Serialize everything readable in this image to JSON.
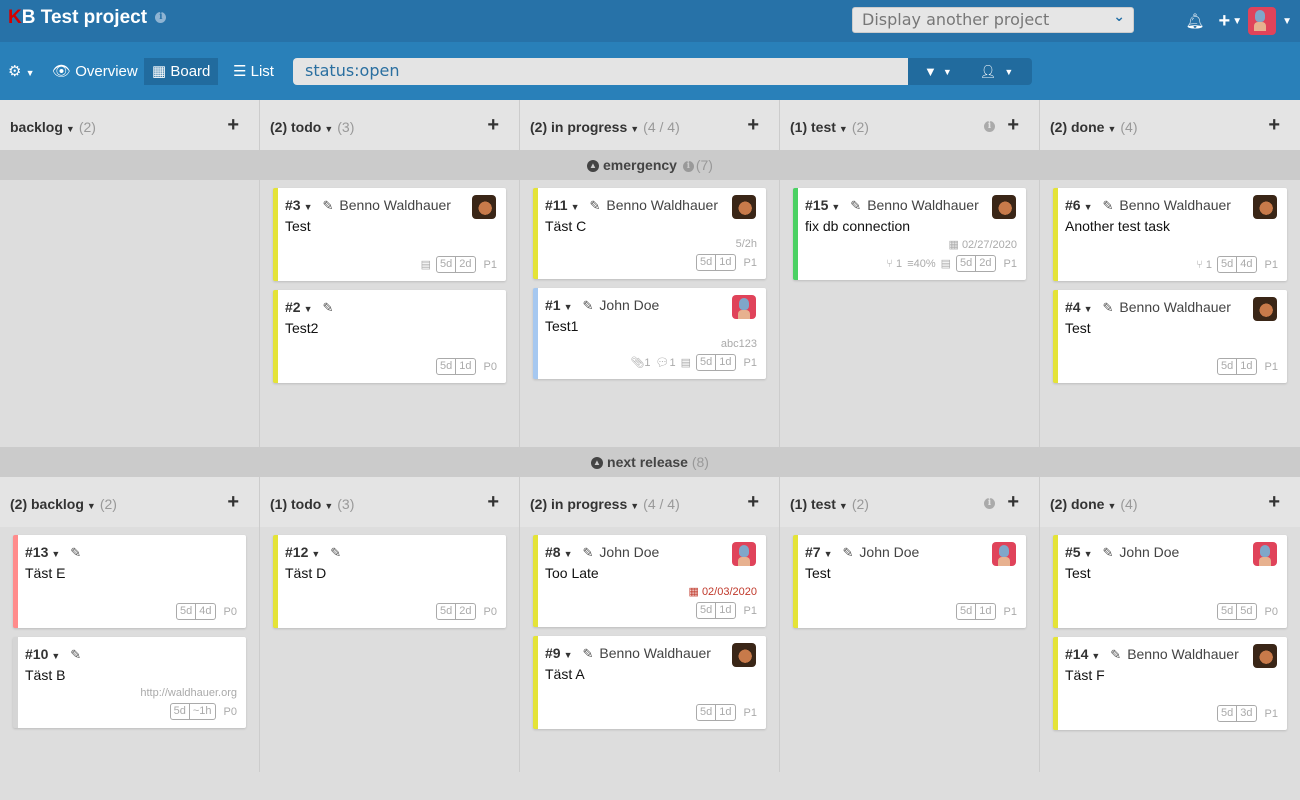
{
  "header": {
    "logo_first": "K",
    "logo_rest": "B",
    "project_title": "Test project",
    "project_selector_placeholder": "Display another project"
  },
  "subnav": {
    "settings_icon": "gear-icon",
    "overview_label": "Overview",
    "board_label": "Board",
    "list_label": "List",
    "search_value": "status:open"
  },
  "swimlanes": [
    {
      "name": "emergency",
      "count": "(7)",
      "has_info": true,
      "columns": [
        {
          "label": "backlog",
          "count": "(2)",
          "info": false,
          "cards": []
        },
        {
          "label": "(2) todo",
          "count": "(3)",
          "info": false,
          "cards": [
            {
              "id": "#3",
              "owner": "Benno Waldhauer",
              "avatar": "benno",
              "title": "Test",
              "color": "#e4e337",
              "meta": "",
              "foot": {
                "desc": true,
                "est": [
                  "5d",
                  "2d"
                ],
                "priority": "P1"
              }
            },
            {
              "id": "#2",
              "owner": "",
              "avatar": "",
              "title": "Test2",
              "color": "#e4e337",
              "meta": "",
              "foot": {
                "est": [
                  "5d",
                  "1d"
                ],
                "priority": "P0"
              }
            }
          ]
        },
        {
          "label": "(2) in progress",
          "count": "(4 / 4)",
          "info": false,
          "cards": [
            {
              "id": "#11",
              "owner": "Benno Waldhauer",
              "avatar": "benno",
              "title": "Täst C",
              "color": "#e4e337",
              "meta": "5/2h",
              "foot": {
                "est": [
                  "5d",
                  "1d"
                ],
                "priority": "P1"
              }
            },
            {
              "id": "#1",
              "owner": "John Doe",
              "avatar": "john",
              "title": "Test1",
              "color": "#a6c8f0",
              "meta": "abc123",
              "foot": {
                "attachments": "1",
                "comments": "1",
                "desc": true,
                "est": [
                  "5d",
                  "1d"
                ],
                "priority": "P1"
              }
            }
          ]
        },
        {
          "label": "(1) test",
          "count": "(2)",
          "info": true,
          "cards": [
            {
              "id": "#15",
              "owner": "Benno Waldhauer",
              "avatar": "benno",
              "title": "fix db connection",
              "color": "#4bd163",
              "meta": "02/27/2020",
              "meta_icon": "calendar",
              "foot": {
                "links": "1",
                "progress": "40%",
                "desc": true,
                "est": [
                  "5d",
                  "2d"
                ],
                "priority": "P1"
              }
            }
          ]
        },
        {
          "label": "(2) done",
          "count": "(4)",
          "info": false,
          "cards": [
            {
              "id": "#6",
              "owner": "Benno Waldhauer",
              "avatar": "benno",
              "title": "Another test task",
              "color": "#e4e337",
              "meta": "",
              "foot": {
                "links": "1",
                "est": [
                  "5d",
                  "4d"
                ],
                "priority": "P1"
              }
            },
            {
              "id": "#4",
              "owner": "Benno Waldhauer",
              "avatar": "benno",
              "title": "Test",
              "color": "#e4e337",
              "meta": "",
              "foot": {
                "est": [
                  "5d",
                  "1d"
                ],
                "priority": "P1"
              }
            }
          ]
        }
      ]
    },
    {
      "name": "next release",
      "count": "(8)",
      "has_info": false,
      "columns": [
        {
          "label": "(2) backlog",
          "count": "(2)",
          "info": false,
          "cards": [
            {
              "id": "#13",
              "owner": "",
              "avatar": "",
              "title": "Täst E",
              "color": "#ff8c8c",
              "meta": "",
              "foot": {
                "est": [
                  "5d",
                  "4d"
                ],
                "priority": "P0"
              }
            },
            {
              "id": "#10",
              "owner": "",
              "avatar": "",
              "title": "Täst B",
              "color": "#d5d5d5",
              "meta": "http://waldhauer.org",
              "foot": {
                "est": [
                  "5d",
                  "~1h"
                ],
                "priority": "P0"
              }
            }
          ]
        },
        {
          "label": "(1) todo",
          "count": "(3)",
          "info": false,
          "cards": [
            {
              "id": "#12",
              "owner": "",
              "avatar": "",
              "title": "Täst D",
              "color": "#e4e337",
              "meta": "",
              "foot": {
                "est": [
                  "5d",
                  "2d"
                ],
                "priority": "P0"
              }
            }
          ]
        },
        {
          "label": "(2) in progress",
          "count": "(4 / 4)",
          "info": false,
          "cards": [
            {
              "id": "#8",
              "owner": "John Doe",
              "avatar": "john",
              "title": "Too Late",
              "color": "#e4e337",
              "meta": "02/03/2020",
              "meta_icon": "calendar",
              "meta_overdue": true,
              "foot": {
                "est": [
                  "5d",
                  "1d"
                ],
                "priority": "P1"
              }
            },
            {
              "id": "#9",
              "owner": "Benno Waldhauer",
              "avatar": "benno",
              "title": "Täst A",
              "color": "#e4e337",
              "meta": "",
              "foot": {
                "est": [
                  "5d",
                  "1d"
                ],
                "priority": "P1"
              }
            }
          ]
        },
        {
          "label": "(1) test",
          "count": "(2)",
          "info": true,
          "cards": [
            {
              "id": "#7",
              "owner": "John Doe",
              "avatar": "john",
              "title": "Test",
              "color": "#e4e337",
              "meta": "",
              "foot": {
                "est": [
                  "5d",
                  "1d"
                ],
                "priority": "P1"
              }
            }
          ]
        },
        {
          "label": "(2) done",
          "count": "(4)",
          "info": false,
          "cards": [
            {
              "id": "#5",
              "owner": "John Doe",
              "avatar": "john",
              "title": "Test",
              "color": "#e4e337",
              "meta": "",
              "foot": {
                "est": [
                  "5d",
                  "5d"
                ],
                "priority": "P0"
              }
            },
            {
              "id": "#14",
              "owner": "Benno Waldhauer",
              "avatar": "benno",
              "title": "Täst F",
              "color": "#e4e337",
              "meta": "",
              "foot": {
                "est": [
                  "5d",
                  "3d"
                ],
                "priority": "P1"
              }
            }
          ]
        }
      ]
    }
  ]
}
